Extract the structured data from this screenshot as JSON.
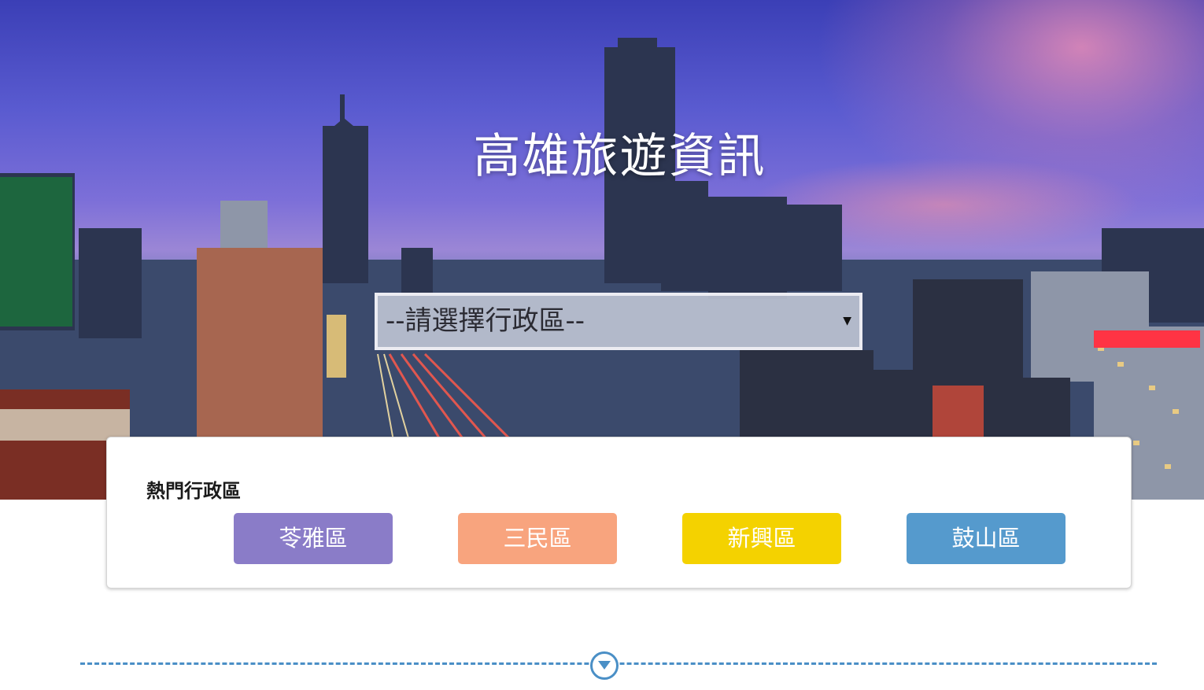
{
  "header": {
    "title": "高雄旅遊資訊"
  },
  "search": {
    "select_value": "--請選擇行政區--"
  },
  "hot_districts": {
    "title": "熱門行政區",
    "items": [
      {
        "label": "苓雅區",
        "color": "#8a7cc8"
      },
      {
        "label": "三民區",
        "color": "#f8a47e"
      },
      {
        "label": "新興區",
        "color": "#f4d200"
      },
      {
        "label": "鼓山區",
        "color": "#559acd"
      }
    ]
  },
  "colors": {
    "accent": "#4a8fc6"
  },
  "icons": {
    "select_arrow": "chevron-down-icon",
    "scroll_down": "circle-chevron-down-icon"
  }
}
